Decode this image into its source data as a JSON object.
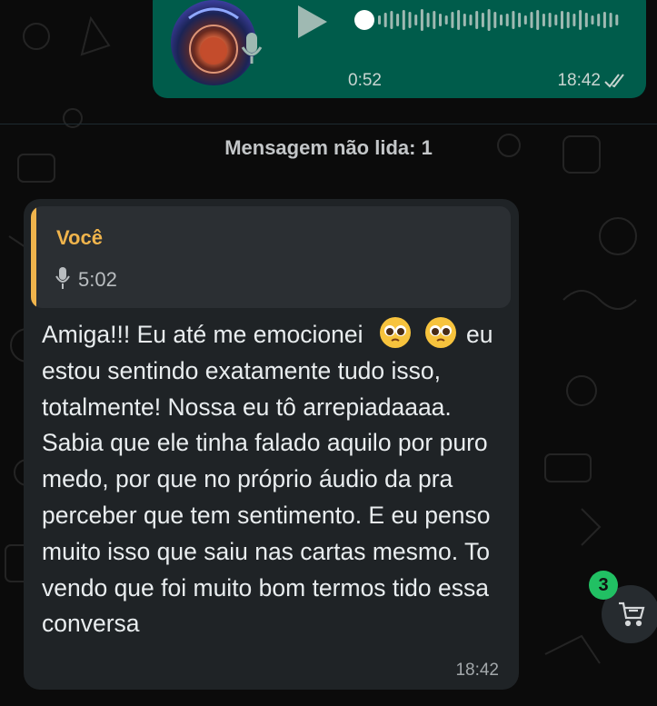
{
  "outgoing_audio": {
    "duration": "0:52",
    "time": "18:42"
  },
  "unread_banner": "Mensagem não lida: 1",
  "incoming_message": {
    "quote": {
      "author": "Você",
      "audio_duration": "5:02"
    },
    "text_line1": "Amiga!!! Eu até me emocionei",
    "text_line2": "eu estou sentindo exatamente tudo isso, totalmente! Nossa eu tô arrepiadaaaa. Sabia que ele tinha falado aquilo por puro medo, por que no próprio áudio da pra perceber que tem sentimento. E eu penso muito isso que saiu nas cartas mesmo. To vendo que foi muito bom termos tido essa conversa",
    "emoji": "pleading-face",
    "time": "18:42"
  },
  "floating_button": {
    "badge_count": "3",
    "icon": "cart-icon"
  },
  "colors": {
    "outgoing_bubble": "#005c4b",
    "incoming_bubble": "#1f2326",
    "quote_accent": "#f0b44c",
    "badge": "#21c063"
  }
}
